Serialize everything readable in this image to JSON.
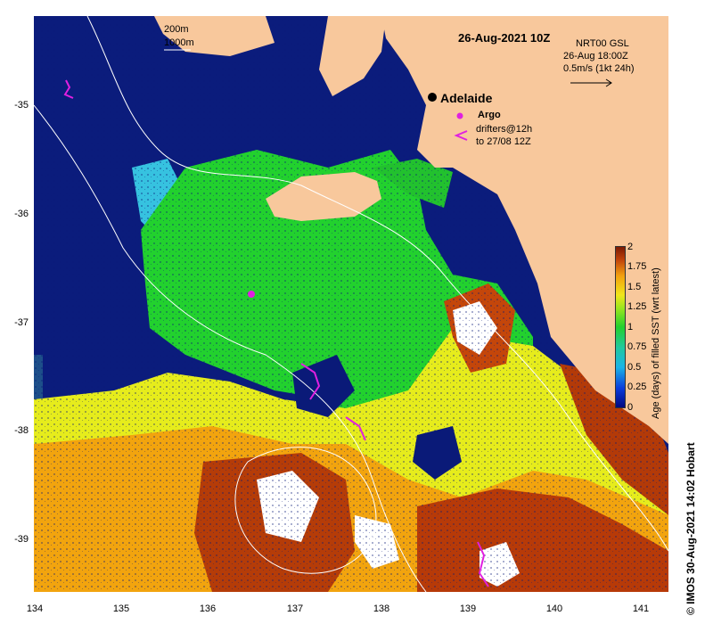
{
  "map": {
    "date_title": "26-Aug-2021 10Z",
    "place_label": "Adelaide",
    "bathy_legend": [
      "200m",
      "1000m"
    ],
    "current_model": "NRT00 GSL",
    "current_time": "26-Aug 18:00Z",
    "current_scale": "0.5m/s (1kt 24h)",
    "argo_label": "Argo",
    "drifters_label_1": "drifters@12h",
    "drifters_label_2": "to 27/08 12Z",
    "y_ticks": [
      "-35",
      "-36",
      "-37",
      "-38",
      "-39"
    ],
    "x_ticks": [
      "134",
      "135",
      "136",
      "137",
      "138",
      "139",
      "140",
      "141"
    ],
    "lon_range": [
      134,
      141.3
    ],
    "lat_range": [
      -34.2,
      -39.5
    ],
    "colors": {
      "land": "#f8c89c",
      "sea_old": "#0a1a78",
      "white_gap": "#ffffff",
      "marker_argo": "#e020e0",
      "drifter": "#e020e0"
    }
  },
  "colorbar": {
    "title": "Age (days) of filled SST (wrt latest)",
    "labels": [
      "2",
      "1.75",
      "1.5",
      "1.25",
      "1",
      "0.75",
      "0.5",
      "0.25",
      "0"
    ],
    "range": [
      0,
      2
    ]
  },
  "credit": "© IMOS 30-Aug-2021 14:02 Hobart"
}
